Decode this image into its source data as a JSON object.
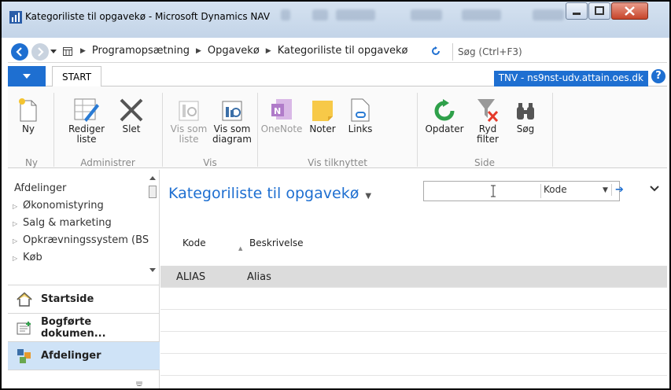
{
  "window": {
    "title": "Kategoriliste til opgavekø - Microsoft Dynamics NAV"
  },
  "address": {
    "breadcrumbs": [
      "Programopsætning",
      "Opgavekø",
      "Kategoriliste til opgavekø"
    ],
    "search_placeholder": "Søg (Ctrl+F3)"
  },
  "tabs": {
    "start_label": "START",
    "environment_label": "TNV - ns9nst-udv.attain.oes.dk"
  },
  "ribbon": {
    "buttons": {
      "new": "Ny",
      "edit_list_1": "Rediger",
      "edit_list_2": "liste",
      "delete": "Slet",
      "view_list_1": "Vis som",
      "view_list_2": "liste",
      "view_chart_1": "Vis som",
      "view_chart_2": "diagram",
      "onenote": "OneNote",
      "notes": "Noter",
      "links": "Links",
      "refresh": "Opdater",
      "clear_filter_1": "Ryd",
      "clear_filter_2": "filter",
      "find": "Søg"
    },
    "groups": {
      "new": "Ny",
      "manage": "Administrer",
      "view": "Vis",
      "show_attached": "Vis tilknyttet",
      "page": "Side"
    }
  },
  "navigation": {
    "tree_header": "Afdelinger",
    "tree_items": [
      "Økonomistyring",
      "Salg & marketing",
      "Opkrævningssystem (BS",
      "Køb"
    ],
    "buttons": [
      "Startside",
      "Bogførte dokumen...",
      "Afdelinger"
    ],
    "active_button": "Afdelinger"
  },
  "content": {
    "page_title": "Kategoriliste til opgavekø",
    "filter_field": "Kode",
    "columns": [
      "Kode",
      "Beskrivelse"
    ],
    "rows": [
      {
        "code": "ALIAS",
        "description": "Alias"
      }
    ]
  },
  "colors": {
    "accent": "#1e6fd1",
    "selected_row": "#dcdcdc",
    "active_nav": "#cfe3f7"
  }
}
